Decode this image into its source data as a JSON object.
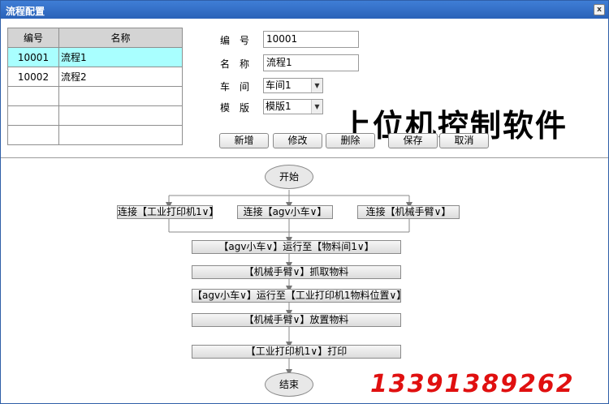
{
  "window": {
    "title": "流程配置",
    "close_label": "x"
  },
  "table": {
    "headers": [
      "编号",
      "名称"
    ],
    "rows": [
      {
        "id": "10001",
        "name": "流程1",
        "selected": true
      },
      {
        "id": "10002",
        "name": "流程2",
        "selected": false
      },
      {
        "id": "",
        "name": "",
        "selected": false
      },
      {
        "id": "",
        "name": "",
        "selected": false
      },
      {
        "id": "",
        "name": "",
        "selected": false
      }
    ]
  },
  "form": {
    "code_label": "编　号",
    "code_value": "10001",
    "name_label": "名　称",
    "name_value": "流程1",
    "workshop_label": "车　间",
    "workshop_value": "车间1",
    "template_label": "模　版",
    "template_value": "模版1"
  },
  "buttons": {
    "add": "新增",
    "edit": "修改",
    "delete": "删除",
    "save": "保存",
    "cancel": "取消"
  },
  "watermark": "上位机控制软件",
  "phone": "13391389262",
  "flow": {
    "start": "开始",
    "branches": [
      "连接【工业打印机1∨】",
      "连接【agv小车∨】",
      "连接【机械手臂∨】"
    ],
    "steps": [
      "【agv小车∨】运行至【物料间1∨】",
      "【机械手臂∨】抓取物料",
      "【agv小车∨】运行至【工业打印机1物料位置∨】",
      "【机械手臂∨】放置物料",
      "【工业打印机1∨】打印"
    ],
    "end": "结束"
  }
}
